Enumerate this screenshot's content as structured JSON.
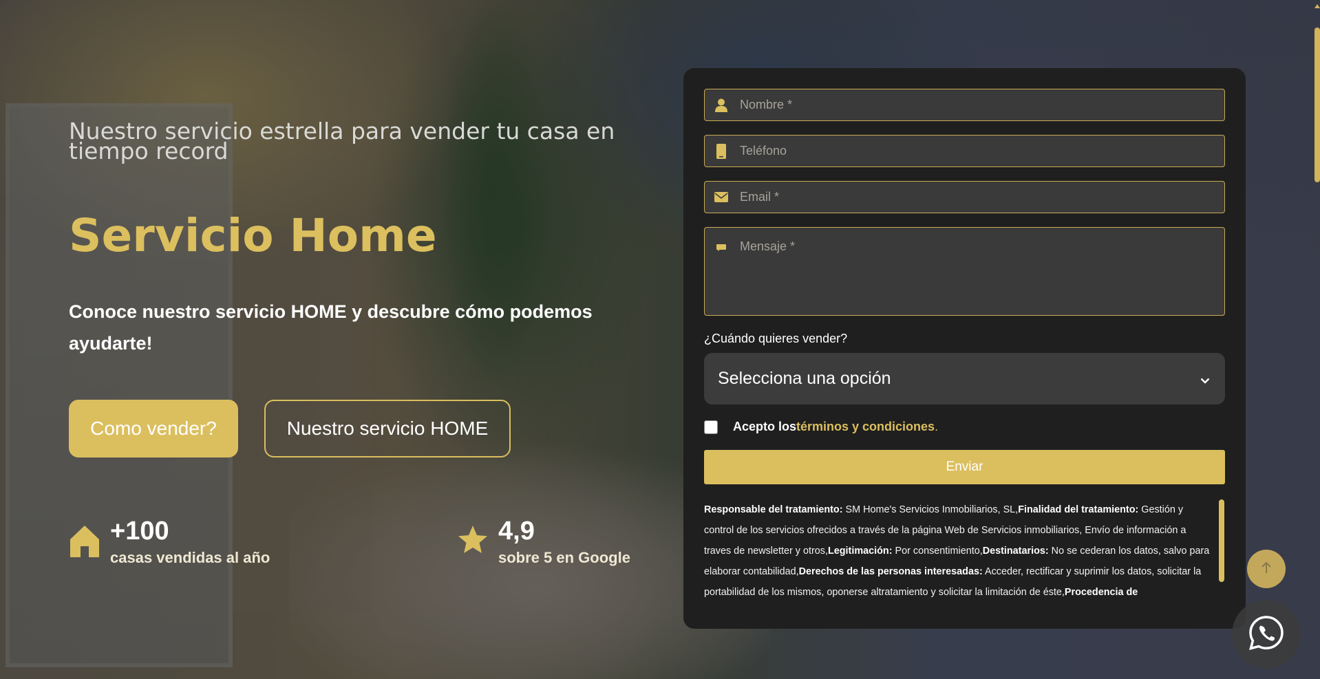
{
  "hero": {
    "tagline": "Nuestro servicio estrella para vender tu casa en tiempo record",
    "title": "Servicio Home",
    "subtitle": "Conoce nuestro servicio HOME y descubre cómo podemos ayudarte!",
    "buttons": {
      "primary_label": "Como vender?",
      "secondary_label": "Nuestro servicio HOME"
    },
    "stats": [
      {
        "icon": "house-icon",
        "value": "+100",
        "label": "casas vendidas al año"
      },
      {
        "icon": "star-icon",
        "value": "4,9",
        "label": "sobre 5 en Google"
      }
    ]
  },
  "form": {
    "name_placeholder": "Nombre *",
    "phone_placeholder": "Teléfono",
    "email_placeholder": "Email *",
    "message_placeholder": "Mensaje *",
    "when_label": "¿Cuándo quieres vender?",
    "select_value": "Selecciona una opción",
    "terms_prefix": "Acepto los ",
    "terms_link": "términos y condiciones",
    "terms_suffix": ".",
    "terms_checked": false,
    "submit_label": "Enviar",
    "legal": [
      {
        "bold": "Responsable del tratamiento:",
        "text": " SM Home's Servicios Inmobiliarios, SL,"
      },
      {
        "bold": "Finalidad del tratamiento:",
        "text": " Gestión y control de los servicios ofrecidos a través de la página Web de Servicios inmobiliarios, Envío de información a traves de newsletter y otros,"
      },
      {
        "bold": "Legitimación:",
        "text": " Por consentimiento,"
      },
      {
        "bold": "Destinatarios:",
        "text": " No se cederan los datos, salvo para elaborar contabilidad,"
      },
      {
        "bold": "Derechos de las personas interesadas:",
        "text": " Acceder, rectificar y suprimir los datos, solicitar la portabilidad de los mismos, oponerse altratamiento y solicitar la limitación de éste,"
      },
      {
        "bold": "Procedencia de",
        "text": ""
      }
    ]
  },
  "colors": {
    "accent": "#dbbf5f",
    "panel": "#1f1f1f",
    "field": "#3a3a3a"
  },
  "widgets": {
    "scroll_top_icon": "arrow-up-icon",
    "whatsapp_icon": "whatsapp-icon"
  }
}
